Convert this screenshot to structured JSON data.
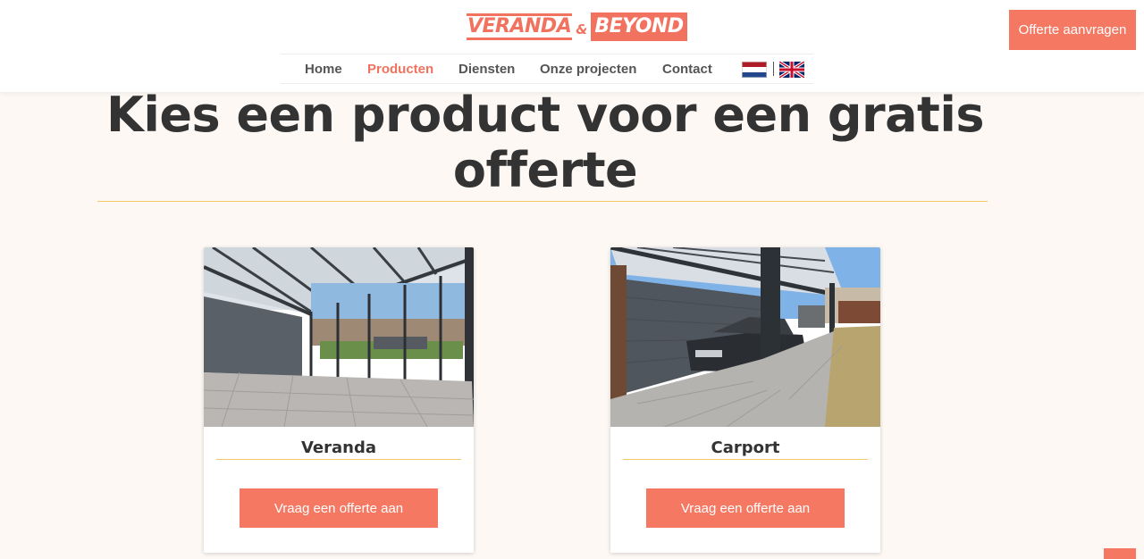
{
  "brand": {
    "logo_part1": "VERANDA",
    "logo_amp": "&",
    "logo_part2": "BEYOND",
    "accent_color": "#f57863",
    "rule_color": "#f0c96a"
  },
  "nav": {
    "items": [
      {
        "label": "Home",
        "active": false
      },
      {
        "label": "Producten",
        "active": true
      },
      {
        "label": "Diensten",
        "active": false
      },
      {
        "label": "Onze projecten",
        "active": false
      },
      {
        "label": "Contact",
        "active": false
      }
    ],
    "flags": [
      "nl-flag-icon",
      "uk-flag-icon"
    ]
  },
  "header": {
    "cta_label": "Offerte aanvragen"
  },
  "main": {
    "title_line1": "Kies een product voor een gratis",
    "title_line2": "offerte",
    "cards": [
      {
        "title": "Veranda",
        "button": "Vraag een offerte aan",
        "image": "veranda-photo"
      },
      {
        "title": "Carport",
        "button": "Vraag een offerte aan",
        "image": "carport-photo"
      }
    ]
  }
}
